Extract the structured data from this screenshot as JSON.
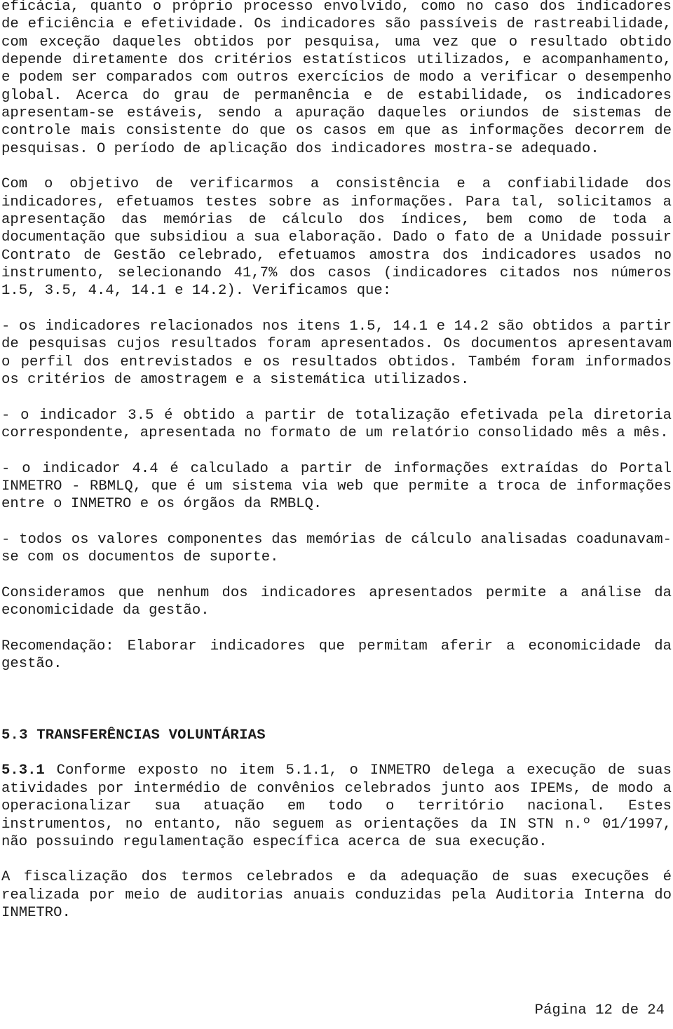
{
  "document": {
    "language": "pt-BR",
    "text_color": "#1b1b1b",
    "background_color": "#ffffff",
    "blocks": [
      {
        "id": "p1",
        "type": "paragraph",
        "text": "eficácia, quanto o próprio processo envolvido, como no caso dos indicadores de eficiência e efetividade. Os indicadores são passíveis de rastreabilidade, com exceção daqueles obtidos por pesquisa, uma vez que o resultado obtido depende diretamente dos critérios estatísticos utilizados, e acompanhamento, e podem ser comparados com outros exercícios de modo a verificar o desempenho global. Acerca do grau de permanência e de estabilidade, os indicadores apresentam-se estáveis, sendo a apuração daqueles oriundos de sistemas de controle mais consistente do que os casos em que as informações decorrem de pesquisas. O período de aplicação dos indicadores mostra-se adequado."
      },
      {
        "id": "p2",
        "type": "paragraph",
        "text": "Com o objetivo de verificarmos a consistência e a confiabilidade dos indicadores, efetuamos testes sobre as informações. Para tal, solicitamos a apresentação das memórias de cálculo dos índices, bem como de toda a documentação que subsidiou a sua elaboração. Dado o fato de a Unidade possuir Contrato de Gestão celebrado, efetuamos amostra dos indicadores usados no instrumento, selecionando 41,7% dos casos (indicadores citados nos números 1.5, 3.5, 4.4, 14.1 e 14.2). Verificamos que:"
      },
      {
        "id": "p3",
        "type": "paragraph",
        "text": "- os indicadores relacionados nos itens 1.5, 14.1 e 14.2 são obtidos a partir de pesquisas cujos resultados foram apresentados. Os documentos apresentavam o perfil dos entrevistados e os resultados obtidos. Também foram informados os critérios de amostragem e a sistemática utilizados."
      },
      {
        "id": "p4",
        "type": "paragraph",
        "text": "- o indicador 3.5 é obtido a partir de totalização efetivada pela diretoria correspondente, apresentada no formato de um relatório consolidado mês a mês."
      },
      {
        "id": "p5",
        "type": "paragraph",
        "text": "- o indicador 4.4 é calculado a partir de informações extraídas do Portal INMETRO - RBMLQ, que é um sistema via web que permite a troca de informações entre o INMETRO e os órgãos da RMBLQ."
      },
      {
        "id": "p6",
        "type": "paragraph",
        "text": "- todos os valores componentes das memórias de cálculo analisadas coadunavam-se com os documentos de suporte."
      },
      {
        "id": "p7",
        "type": "paragraph",
        "text": "Consideramos que nenhum dos indicadores apresentados permite a análise da economicidade da gestão."
      },
      {
        "id": "p8",
        "type": "paragraph",
        "text": "Recomendação: Elaborar indicadores que permitam aferir a economicidade da gestão."
      },
      {
        "id": "h1",
        "type": "heading",
        "number": "5.3",
        "text": "5.3 TRANSFERÊNCIAS VOLUNTÁRIAS"
      },
      {
        "id": "p9",
        "type": "paragraph_numbered",
        "number": "5.3.1",
        "text_after_number": " Conforme exposto no item 5.1.1, o INMETRO delega a execução de suas atividades por intermédio de convênios celebrados junto aos IPEMs, de modo a operacionalizar sua atuação em todo o território nacional. Estes instrumentos, no entanto, não seguem as orientações da IN STN n.º 01/1997, não possuindo regulamentação específica acerca de sua execução."
      },
      {
        "id": "p10",
        "type": "paragraph",
        "text": "A fiscalização dos termos celebrados e da adequação de suas execuções é realizada por meio de auditorias anuais conduzidas pela Auditoria Interna do INMETRO."
      }
    ]
  },
  "footer": {
    "page_label": "Página 12 de 24",
    "current_page": "12",
    "total_pages": "24"
  }
}
